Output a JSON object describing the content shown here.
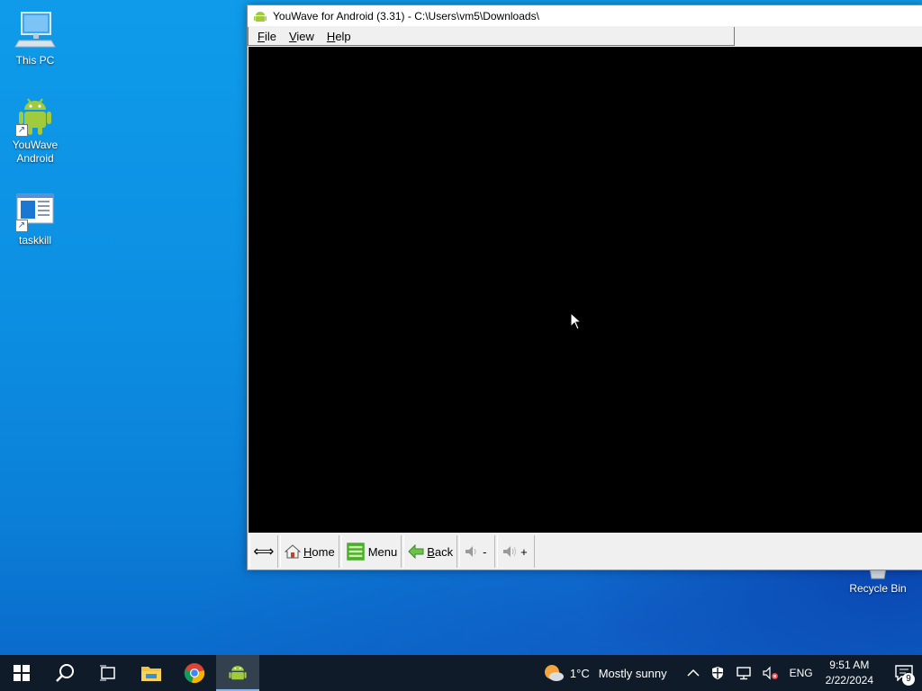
{
  "desktop": {
    "icons": [
      {
        "label": "This PC"
      },
      {
        "label": "YouWave Android"
      },
      {
        "label": "taskkill"
      },
      {
        "label": "Recycle Bin"
      }
    ]
  },
  "window": {
    "title": "YouWave for Android (3.31) - C:\\Users\\vm5\\Downloads\\",
    "menu": [
      "File",
      "View",
      "Help"
    ],
    "nav": {
      "resize_glyph": "⟺",
      "home": "Home",
      "menu": "Menu",
      "back": "Back",
      "vol_down": "-",
      "vol_up": "+"
    }
  },
  "taskbar": {
    "weather_temp": "1°C",
    "weather_text": "Mostly sunny",
    "language": "ENG",
    "time": "9:51 AM",
    "date": "2/22/2024",
    "notification_count": "9"
  },
  "colors": {
    "taskbar_bg": "#0f1b29",
    "android_green": "#9fcb3d",
    "desktop_blue": "#0c8fe2"
  }
}
